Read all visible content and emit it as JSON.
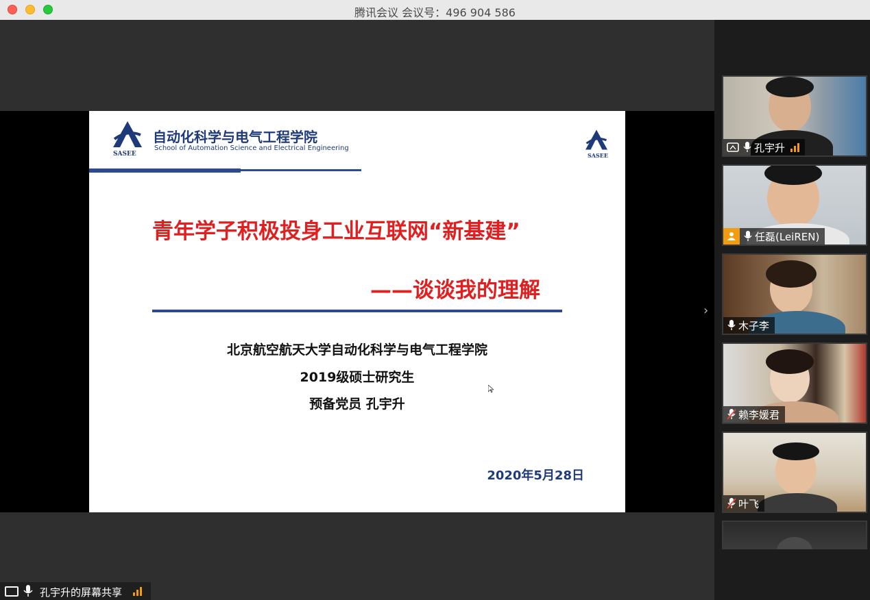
{
  "window": {
    "title": "腾讯会议 会议号：496 904 586"
  },
  "slide": {
    "school_cn": "自动化科学与电气工程学院",
    "school_en": "School of Automation Science and Electrical Engineering",
    "logo_text": "SASEE",
    "title": "青年学子积极投身工业互联网“新基建”",
    "subtitle": "——谈谈我的理解",
    "lines": [
      "北京航空航天大学自动化科学与电气工程学院",
      "2019级硕士研究生",
      "预备党员 孔宇升"
    ],
    "date": "2020年5月28日"
  },
  "share": {
    "label": "孔宇升的屏幕共享"
  },
  "participants": [
    {
      "name": "孔宇升",
      "mic": "on",
      "sharing": true,
      "signal": true
    },
    {
      "name": "任磊(LeiREN)",
      "mic": "on",
      "host": true
    },
    {
      "name": "木子李",
      "mic": "on"
    },
    {
      "name": "赖李媛君",
      "mic": "muted"
    },
    {
      "name": "叶飞",
      "mic": "muted"
    }
  ],
  "colors": {
    "slide_red": "#e02020",
    "slide_blue": "#2e4a8e",
    "signal": "#f39c12",
    "host_badge": "#f39c12"
  }
}
